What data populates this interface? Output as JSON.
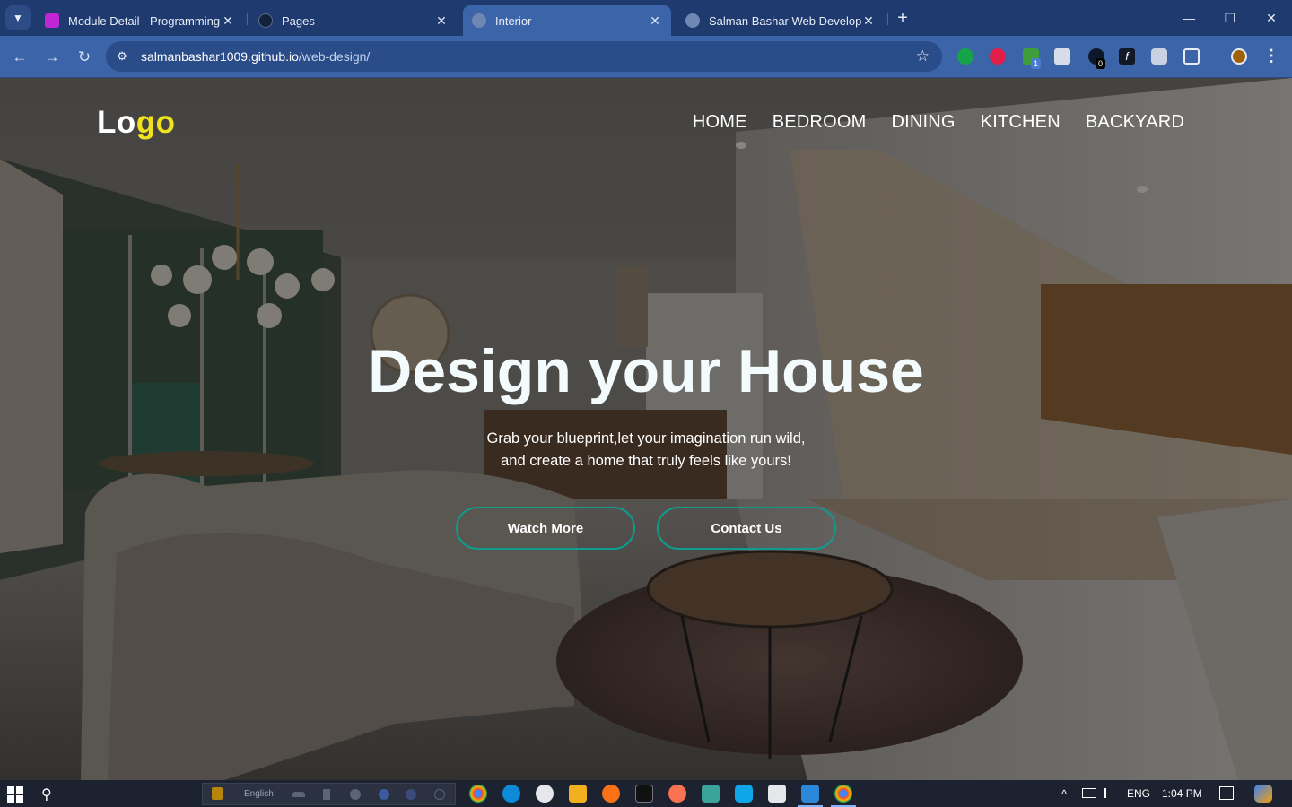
{
  "browser": {
    "tabs": [
      {
        "title": "Module Detail - Programming Hero",
        "active": false
      },
      {
        "title": "Pages",
        "active": false
      },
      {
        "title": "Interior",
        "active": true
      },
      {
        "title": "Salman Bashar Web Developer",
        "active": false
      }
    ],
    "url_host": "salmanbashar1009.github.io",
    "url_path": "/web-design/",
    "extension_badges": [
      "1",
      "0"
    ]
  },
  "site": {
    "logo_main": "Lo",
    "logo_highlight": "go",
    "nav": [
      "HOME",
      "BEDROOM",
      "DINING",
      "KITCHEN",
      "BACKYARD"
    ],
    "hero_title": "Design your House",
    "hero_subtitle_line1": "Grab your blueprint,let your imagination run wild,",
    "hero_subtitle_line2": "and create a home that truly feels like yours!",
    "btn_watch": "Watch More",
    "btn_contact": "Contact Us",
    "colors": {
      "logo_accent": "#f0e31d",
      "button_border": "#0f9b8e"
    }
  },
  "taskbar": {
    "ime_language": "English",
    "tray_lang": "ENG",
    "time": "1:04 PM"
  }
}
